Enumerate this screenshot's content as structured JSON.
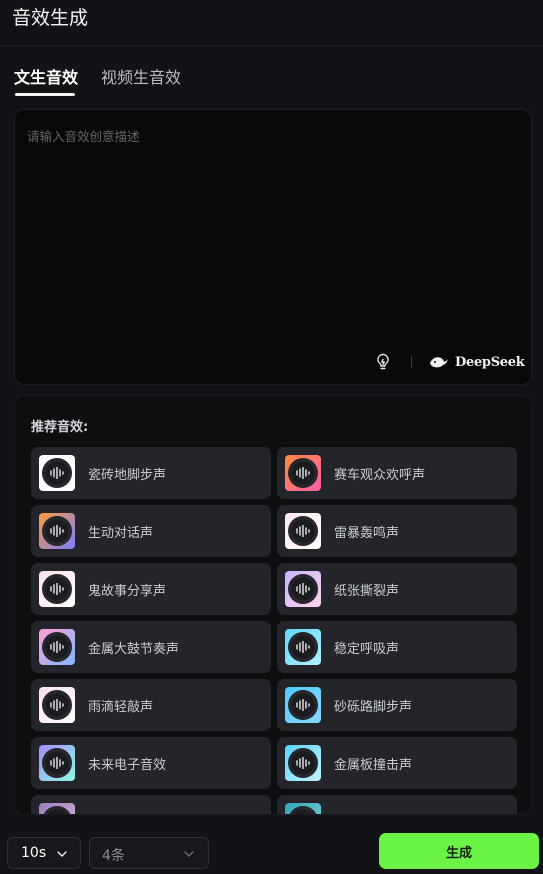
{
  "header": {
    "title": "音效生成"
  },
  "tabs": [
    {
      "label": "文生音效",
      "active": true
    },
    {
      "label": "视频生音效",
      "active": false
    }
  ],
  "prompt": {
    "placeholder": "请输入音效创意描述",
    "value": ""
  },
  "toolbar": {
    "model_label": "DeepSeek",
    "icons": [
      "lightbulb-icon",
      "deepseek-whale-icon"
    ]
  },
  "recommendations": {
    "title": "推荐音效:",
    "items": [
      {
        "label": "瓷砖地脚步声",
        "colors": [
          "#ffffff",
          "#ffffff"
        ]
      },
      {
        "label": "赛车观众欢呼声",
        "colors": [
          "#ff8a3c",
          "#ff5fa8"
        ]
      },
      {
        "label": "生动对话声",
        "colors": [
          "#ff9a3c",
          "#7a7dff"
        ]
      },
      {
        "label": "雷暴轰鸣声",
        "colors": [
          "#ffe6ef",
          "#ffffff"
        ]
      },
      {
        "label": "鬼故事分享声",
        "colors": [
          "#fde0ea",
          "#ffffff"
        ]
      },
      {
        "label": "纸张撕裂声",
        "colors": [
          "#c9b5ff",
          "#ffd2ea"
        ]
      },
      {
        "label": "金属大鼓节奏声",
        "colors": [
          "#ff9fd2",
          "#7fb8ff"
        ]
      },
      {
        "label": "稳定呼吸声",
        "colors": [
          "#5fd6ff",
          "#b3f0ff"
        ]
      },
      {
        "label": "雨滴轻敲声",
        "colors": [
          "#ffe0ea",
          "#ffffff"
        ]
      },
      {
        "label": "砂砾路脚步声",
        "colors": [
          "#4ecbff",
          "#8ad8ff"
        ]
      },
      {
        "label": "未来电子音效",
        "colors": [
          "#a78bff",
          "#8affe0"
        ]
      },
      {
        "label": "金属板撞击声",
        "colors": [
          "#5bd2ff",
          "#c4f5ff"
        ]
      },
      {
        "label": "",
        "colors": [
          "#9a7fbf",
          "#d9b5d9"
        ]
      },
      {
        "label": "",
        "colors": [
          "#2fa5b8",
          "#7fd4d4"
        ]
      }
    ]
  },
  "footer": {
    "duration": {
      "value": "10s"
    },
    "count": {
      "value": "4条"
    },
    "generate_label": "生成"
  },
  "colors": {
    "accent": "#6bf446",
    "background": "#121316",
    "card": "#23252a"
  }
}
